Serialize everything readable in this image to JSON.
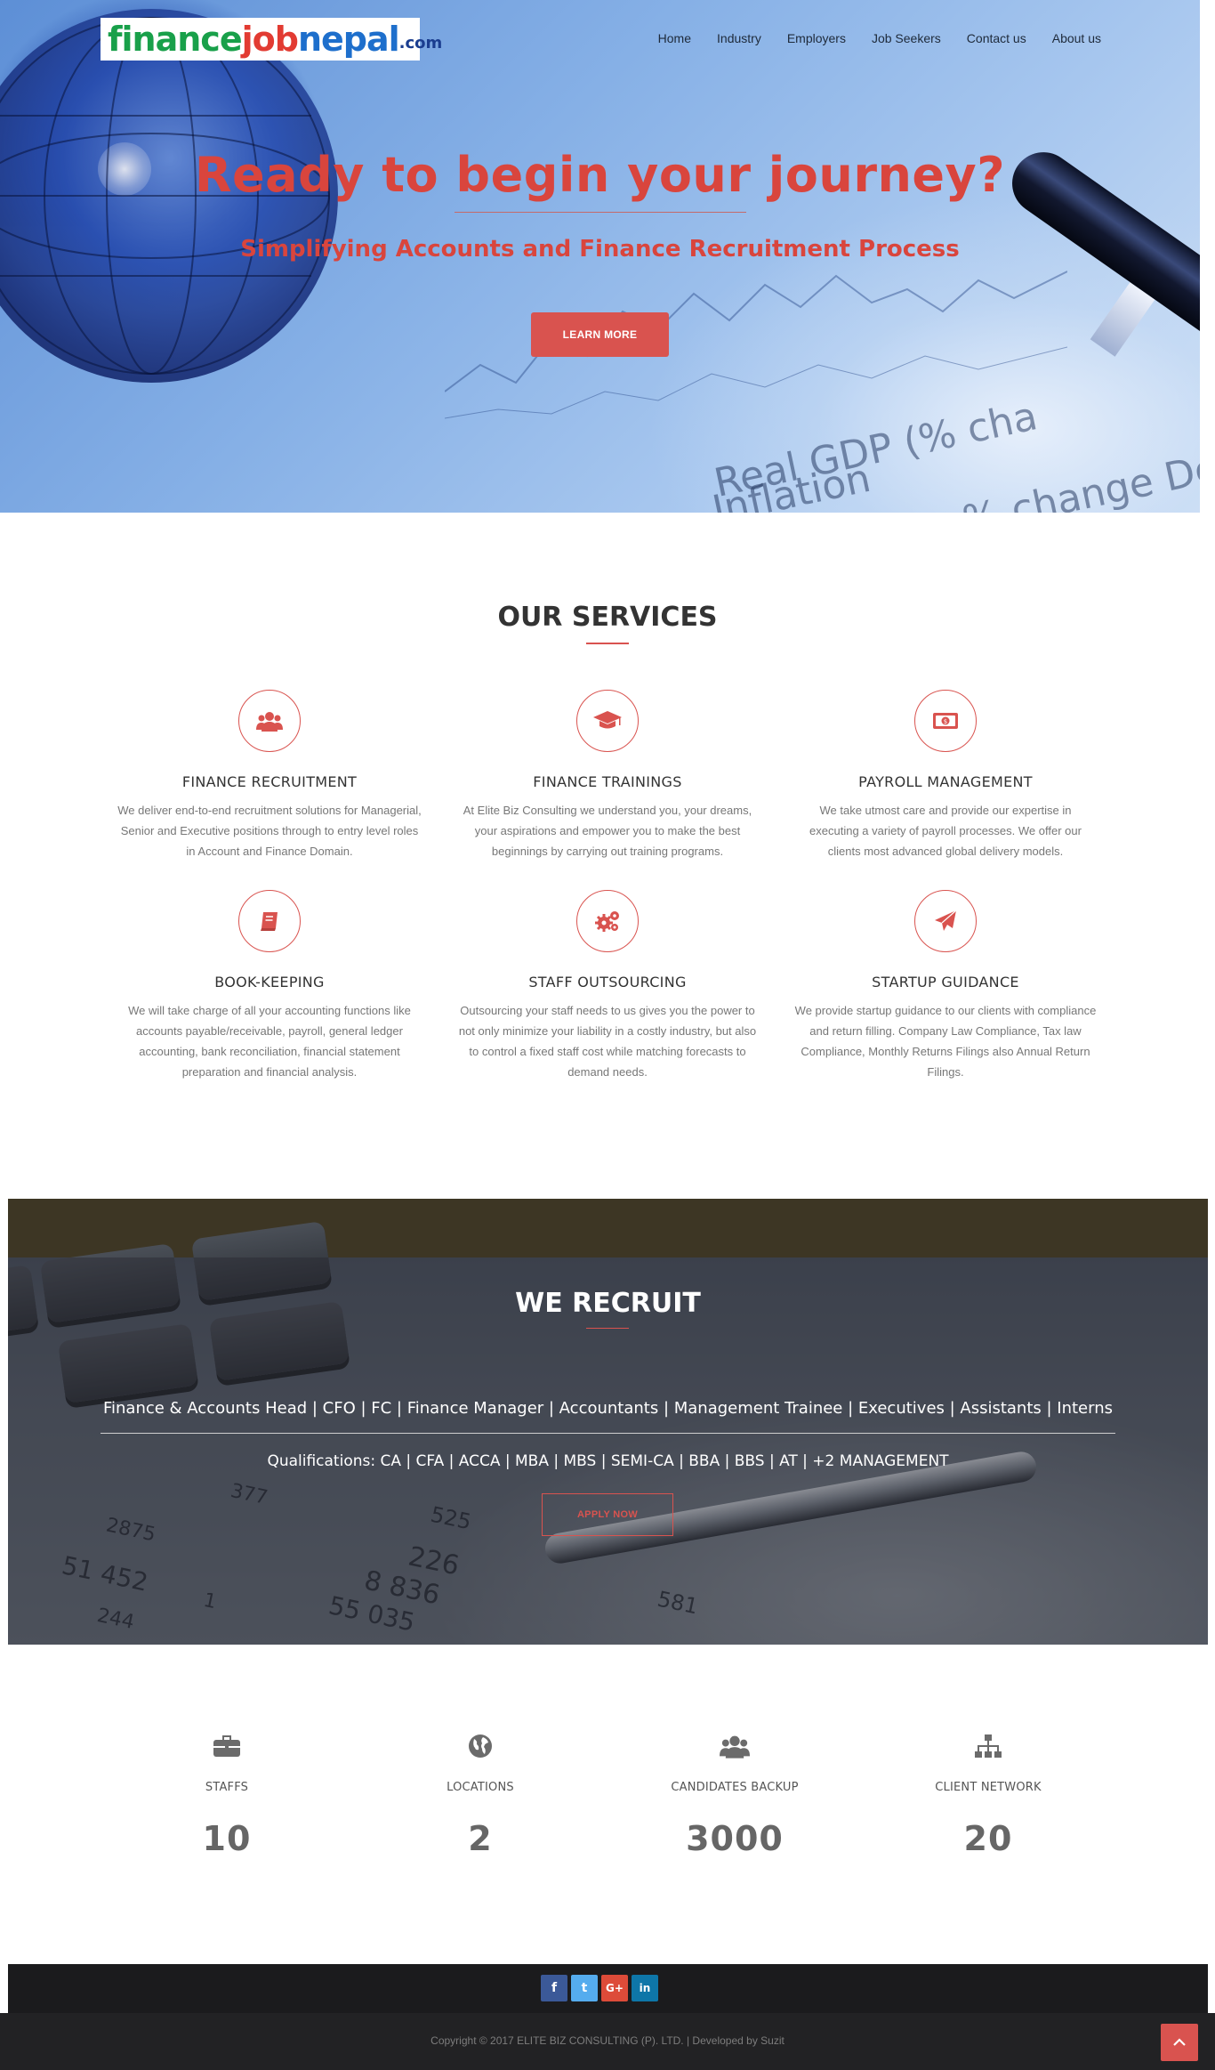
{
  "header": {
    "logo": {
      "finance": "finance",
      "job": "job",
      "nepal": "nepal",
      "com": ".com"
    },
    "nav": [
      "Home",
      "Industry",
      "Employers",
      "Job Seekers",
      "Contact us",
      "About us"
    ]
  },
  "hero": {
    "title": "Ready to begin your journey?",
    "subtitle": "Simplifying Accounts and Finance Recruitment Process",
    "button": "LEARN MORE",
    "background_text": [
      "Real GDP (% cha",
      "Inflation",
      "% change De"
    ]
  },
  "services": {
    "title": "OUR SERVICES",
    "items": [
      {
        "icon": "users-icon",
        "title": "FINANCE RECRUITMENT",
        "text": "We deliver end-to-end recruitment solutions for Managerial, Senior and Executive positions through to entry level roles in Account and Finance Domain."
      },
      {
        "icon": "graduation-cap-icon",
        "title": "FINANCE TRAININGS",
        "text": "At Elite Biz Consulting we understand you, your dreams, your aspirations and empower you to make the best beginnings by carrying out training programs."
      },
      {
        "icon": "money-icon",
        "title": "PAYROLL MANAGEMENT",
        "text": "We take utmost care and provide our expertise in executing a variety of payroll processes. We offer our clients most advanced global delivery models."
      },
      {
        "icon": "book-icon",
        "title": "BOOK-KEEPING",
        "text": "We will take charge of all your accounting functions like accounts payable/receivable, payroll, general ledger accounting, bank reconciliation, financial statement preparation and financial analysis."
      },
      {
        "icon": "gears-icon",
        "title": "STAFF OUTSOURCING",
        "text": "Outsourcing your staff needs to us gives you the power to not only minimize your liability in a costly industry, but also to control a fixed staff cost while matching forecasts to demand needs."
      },
      {
        "icon": "paper-plane-icon",
        "title": "STARTUP GUIDANCE",
        "text": "We provide startup guidance to our clients with compliance and return filling. Company Law Compliance, Tax law Compliance, Monthly Returns Filings also Annual Return Filings."
      }
    ]
  },
  "recruit": {
    "title": "WE RECRUIT",
    "roles": "Finance & Accounts Head | CFO | FC | Finance Manager | Accountants | Management Trainee | Executives | Assistants | Interns",
    "qualifications": "Qualifications: CA | CFA | ACCA | MBA | MBS | SEMI-CA | BBA | BBS | AT | +2 MANAGEMENT",
    "button": "APPLY NOW",
    "background_numbers": [
      "2875",
      "51 452",
      "1",
      "244",
      "55 035",
      "226",
      "8 836",
      "525",
      "581",
      "377"
    ]
  },
  "stats": [
    {
      "icon": "briefcase-icon",
      "label": "STAFFS",
      "value": "10"
    },
    {
      "icon": "globe-icon",
      "label": "LOCATIONS",
      "value": "2"
    },
    {
      "icon": "users-icon",
      "label": "CANDIDATES BACKUP",
      "value": "3000"
    },
    {
      "icon": "sitemap-icon",
      "label": "CLIENT NETWORK",
      "value": "20"
    }
  ],
  "footer": {
    "social": [
      {
        "name": "facebook",
        "glyph": "f",
        "color": "#3b5998"
      },
      {
        "name": "twitter",
        "glyph": "t",
        "color": "#55acee"
      },
      {
        "name": "google-plus",
        "glyph": "G+",
        "color": "#dd4b39"
      },
      {
        "name": "linkedin",
        "glyph": "in",
        "color": "#0e76a8"
      }
    ],
    "copyright": "Copyright © 2017 ELITE BIZ CONSULTING (P). LTD. | Developed by Suzit"
  },
  "colors": {
    "accent": "#d9534f",
    "dark": "#1b1b1d",
    "recruit_band": "#3d3624"
  }
}
